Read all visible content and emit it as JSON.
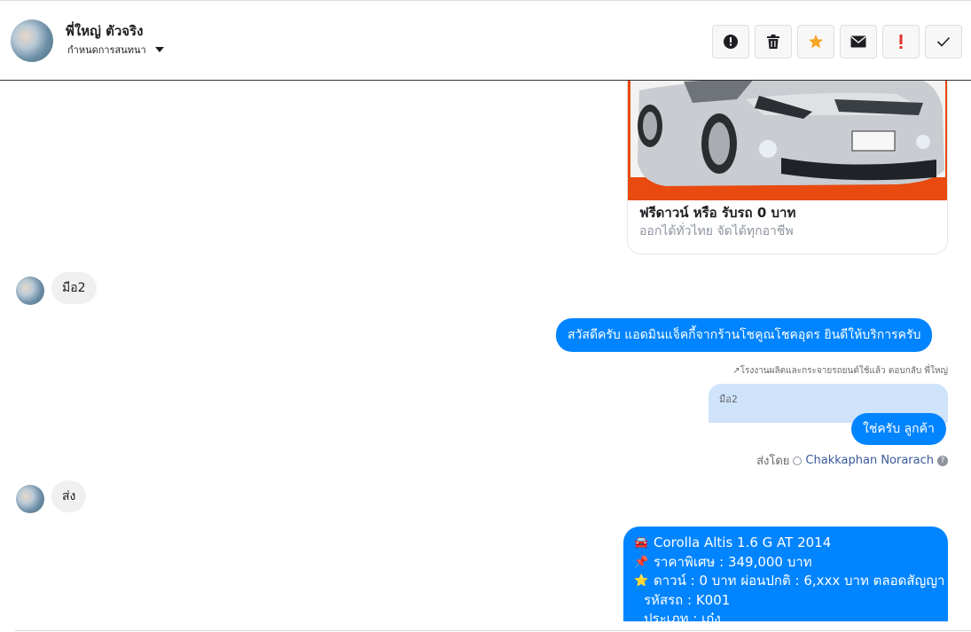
{
  "header": {
    "name": "พี่ใหญ่ ตัวจริง",
    "subtitle": "กำหนดการสนทนา",
    "actions": [
      {
        "icon": "exclamation-circle-icon"
      },
      {
        "icon": "trash-icon"
      },
      {
        "icon": "star-icon",
        "color": "#f5a623"
      },
      {
        "icon": "envelope-icon"
      },
      {
        "icon": "red-exclamation-icon",
        "color": "#e4302b"
      },
      {
        "icon": "check-icon"
      }
    ]
  },
  "card": {
    "title": "ฟรีดาวน์ หรือ รับรถ 0 บาท",
    "description": "ออกได้ทั่วไทย จัดได้ทุกอาชีพ"
  },
  "messages": {
    "incoming_1": "มือ2",
    "outgoing_1": "สวัสดีครับ แอดมินแจ็คกี้จากร้านโชคูณโชคอุดร ยินดีให้บริการครับ",
    "reply_note": "โรงงานผลิตและกระจายรถยนต์ใช้แล้ว ตอบกลับ พี่ใหญ่",
    "quoted": "มือ2",
    "outgoing_2": "ใช่ครับ ลูกค้า",
    "sent_by_label": "ส่งโดย",
    "sent_by_agent": "Chakkaphan Norarach",
    "help": "?",
    "incoming_2": "ส่ง",
    "details": {
      "line1": "Corolla Altis 1.6 G AT 2014",
      "line2": "ราคาพิเศษ : 349,000 บาท",
      "line3": "ดาวน์ : 0 บาท ผ่อนปกติ : 6,xxx บาท ตลอดสัญญา",
      "line4": "รหัสรถ : K001",
      "line5": "ประเภท : เก๋ง"
    }
  },
  "colors": {
    "accent": "#0084ff",
    "incoming_bubble": "#f0f0f0",
    "quoted_bg": "#cfe3fb"
  }
}
